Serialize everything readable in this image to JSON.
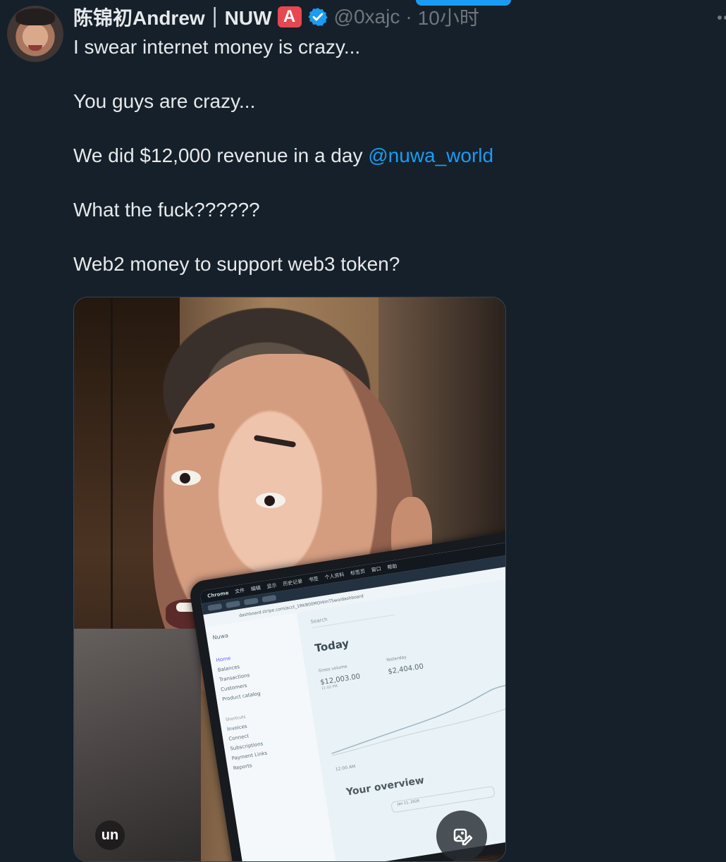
{
  "tweet": {
    "author": {
      "display_name": "陈锦初Andrew｜NUW",
      "name_badge": "A",
      "handle": "@0xajc",
      "separator": "·",
      "time": "10小时"
    },
    "lines": [
      "I swear internet money is crazy...",
      "You guys are crazy...",
      "We did $12,000 revenue in a day ",
      "What the fuck??????",
      "Web2 money to support web3 token?"
    ],
    "mention": "@nuwa_world"
  },
  "media": {
    "overlay_logo": "un",
    "laptop": {
      "menu_bar": [
        "Chrome",
        "文件",
        "编辑",
        "显示",
        "历史记录",
        "书签",
        "个人资料",
        "标签页",
        "窗口",
        "帮助"
      ],
      "address": "dashboard.stripe.com/acct_1RKB00MOHImTSwo/dashboard",
      "company": "Nuwa",
      "search_placeholder": "Search",
      "today_title": "Today",
      "gross_volume_label": "Gross volume",
      "gross_volume_value": "$12,003.00",
      "gross_volume_time": "11:02 PM",
      "yesterday_label": "Yesterday",
      "yesterday_value": "$2,404.00",
      "graph_time": "12:00 AM",
      "overview_title": "Your overview",
      "date_range": "Jan 11, 2026",
      "nav": [
        "Home",
        "Balances",
        "Transactions",
        "Customers",
        "Product catalog"
      ],
      "shortcuts_title": "Shortcuts",
      "shortcuts": [
        "Invoices",
        "Connect",
        "Subscriptions",
        "Payment Links",
        "Reports"
      ]
    }
  },
  "colors": {
    "background": "#15202b",
    "text": "#e7e9ea",
    "muted": "#71767b",
    "link": "#1d9bf0"
  },
  "icons": {
    "verified": "verified-badge-icon",
    "more": "more-horizontal-icon",
    "image_edit": "image-edit-icon"
  }
}
